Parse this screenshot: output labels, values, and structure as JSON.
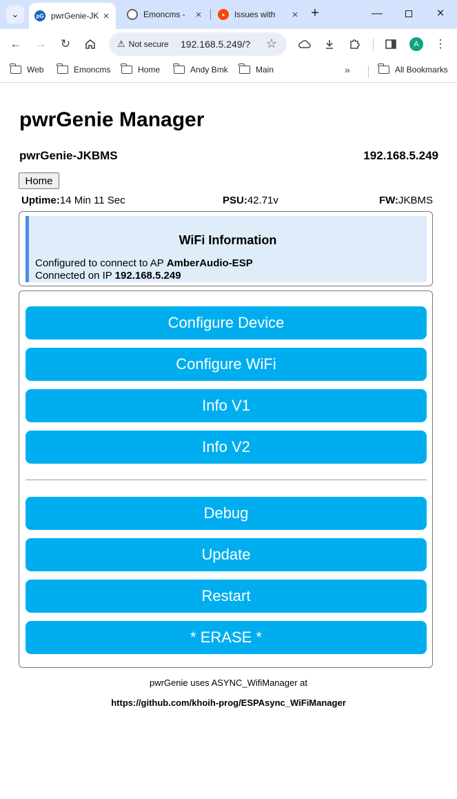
{
  "browser": {
    "tabs": [
      {
        "title": "pwrGenie-JK",
        "favicon": "pG",
        "active": true
      },
      {
        "title": "Emoncms -",
        "active": false
      },
      {
        "title": "Issues with",
        "active": false
      }
    ],
    "security_label": "Not secure",
    "url": "192.168.5.249/?",
    "profile_initial": "A",
    "bookmarks": [
      "Web",
      "Emoncms",
      "Home",
      "Andy Bmk",
      "Main"
    ],
    "all_bookmarks_label": "All Bookmarks",
    "more_bookmarks": "»"
  },
  "page": {
    "title": "pwrGenie Manager",
    "device_name": "pwrGenie-JKBMS",
    "device_ip": "192.168.5.249",
    "home_button": "Home",
    "stats": {
      "uptime_label": "Uptime:",
      "uptime_value": "14 Min 11 Sec",
      "psu_label": "PSU:",
      "psu_value": "42.71v",
      "fw_label": "FW:",
      "fw_value": "JKBMS"
    },
    "wifi": {
      "title": "WiFi Information",
      "configured_text": "Configured to connect to AP ",
      "ap_name": "AmberAudio-ESP",
      "connected_text": "Connected on IP ",
      "ip": "192.168.5.249"
    },
    "buttons": {
      "configure_device": "Configure Device",
      "configure_wifi": "Configure WiFi",
      "info_v1": "Info V1",
      "info_v2": "Info V2",
      "debug": "Debug",
      "update": "Update",
      "restart": "Restart",
      "erase": "* ERASE *"
    },
    "footer": {
      "line1": "pwrGenie uses ASYNC_WifiManager at",
      "line2": "https://github.com/khoih-prog/ESPAsync_WiFiManager"
    }
  },
  "colors": {
    "button_bg": "#00aeef",
    "wifi_bg": "#dfecfa",
    "wifi_accent": "#4a90e2",
    "tabbar_bg": "#d3e3fd"
  }
}
